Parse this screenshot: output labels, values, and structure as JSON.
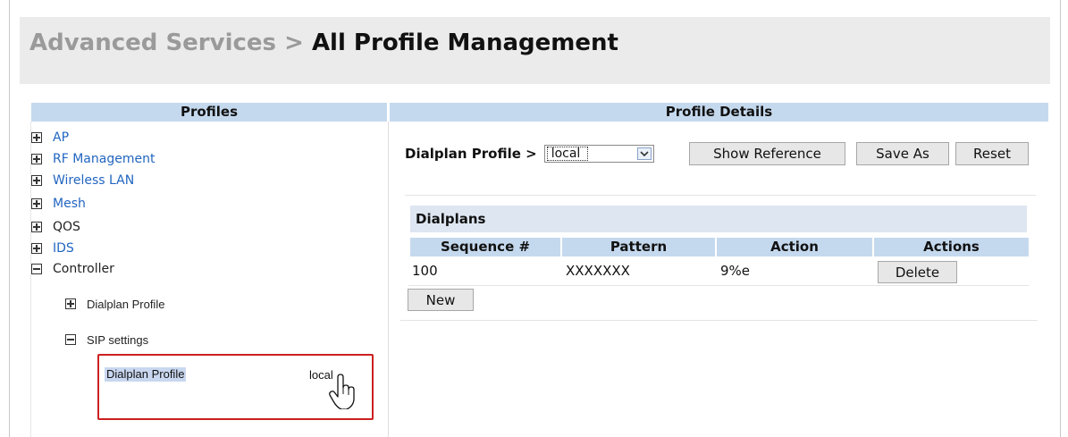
{
  "breadcrumb": {
    "parent": "Advanced Services",
    "separator": ">",
    "current": "All Profile Management"
  },
  "profiles": {
    "header": "Profiles",
    "items": [
      {
        "label": "AP",
        "expander": "plus"
      },
      {
        "label": "RF Management",
        "expander": "plus"
      },
      {
        "label": "Wireless LAN",
        "expander": "plus"
      },
      {
        "label": "Mesh",
        "expander": "plus"
      },
      {
        "label": "QOS",
        "expander": "plus"
      },
      {
        "label": "IDS",
        "expander": "plus"
      },
      {
        "label": "Controller",
        "expander": "minus"
      }
    ],
    "sub_items": [
      {
        "label": "Dialplan Profile",
        "expander": "plus"
      },
      {
        "label": "SIP settings",
        "expander": "minus"
      }
    ],
    "selected": {
      "label": "Dialplan Profile",
      "value": "local"
    }
  },
  "details": {
    "header": "Profile Details",
    "profile_label": "Dialplan Profile >",
    "profile_value": "local",
    "buttons": {
      "show_reference": "Show Reference",
      "save_as": "Save As",
      "reset": "Reset"
    },
    "section_title": "Dialplans",
    "columns": [
      "Sequence #",
      "Pattern",
      "Action",
      "Actions"
    ],
    "rows": [
      {
        "sequence": "100",
        "pattern": "XXXXXXX",
        "action": "9%e",
        "button": "Delete"
      }
    ],
    "new_button": "New"
  },
  "colors": {
    "column_header_bg": "#c5d9ee",
    "section_header_bg": "#dde6f1",
    "link_blue": "#2266c0",
    "selection_border": "#cc2020",
    "header_bg": "#ebebeb"
  }
}
